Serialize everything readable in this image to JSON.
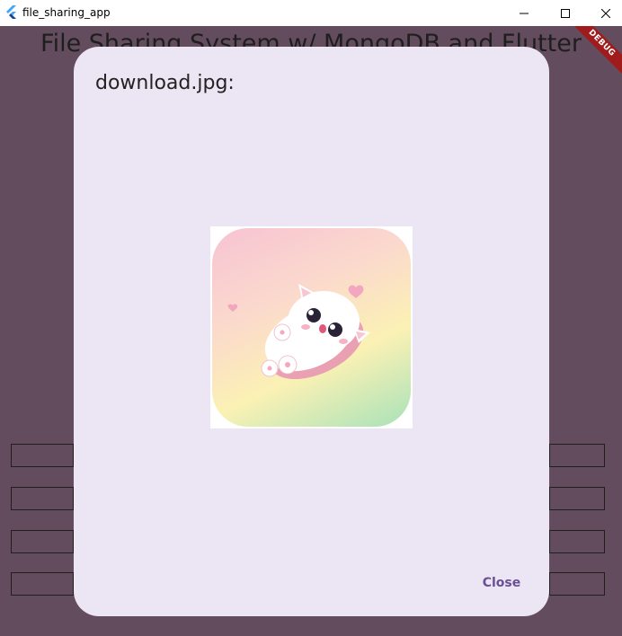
{
  "window": {
    "title": "file_sharing_app",
    "minimize_glyph": "—",
    "maximize_glyph": "☐",
    "close_glyph": "✕"
  },
  "app": {
    "heading": "File Sharing System w/ MongoDB and Flutter",
    "debug_banner": "DEBUG"
  },
  "dialog": {
    "title": "download.jpg:",
    "close_label": "Close"
  },
  "colors": {
    "app_background": "#644c5f",
    "dialog_background": "#ece5f3",
    "accent": "#6a4f96"
  },
  "icons": {
    "app": "flutter-logo-icon",
    "minimize": "minimize-icon",
    "maximize": "maximize-icon",
    "close": "close-icon"
  }
}
